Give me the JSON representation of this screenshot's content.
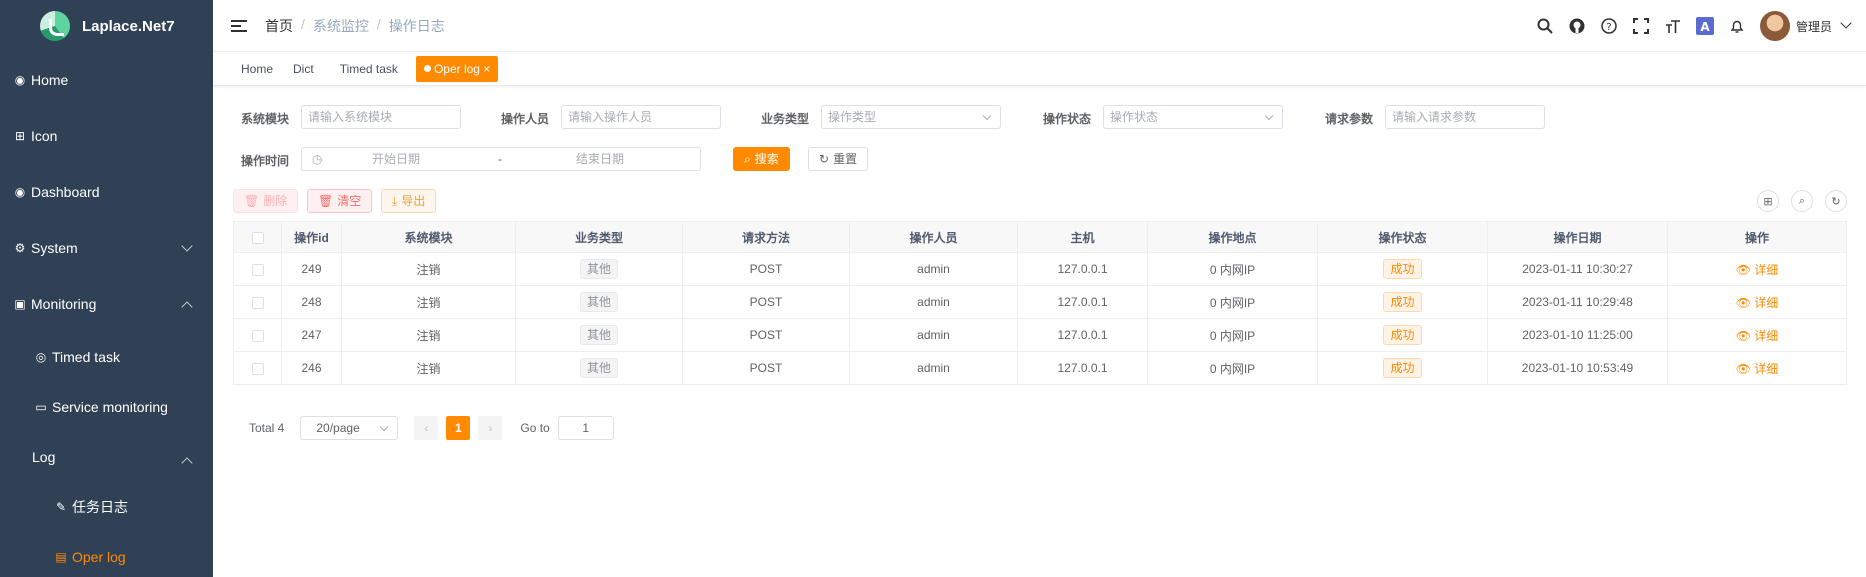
{
  "sidebar": {
    "brand": "Laplace.Net7",
    "items": [
      {
        "label": "Home"
      },
      {
        "label": "Icon"
      },
      {
        "label": "Dashboard"
      },
      {
        "label": "System"
      },
      {
        "label": "Monitoring"
      },
      {
        "label": "Timed task"
      },
      {
        "label": "Service monitoring"
      },
      {
        "label": "Log"
      },
      {
        "label": "任务日志"
      },
      {
        "label": "Oper log"
      }
    ]
  },
  "breadcrumb": [
    "首页",
    "系统监控",
    "操作日志"
  ],
  "header": {
    "user": "管理员"
  },
  "tags": [
    "Home",
    "Dict",
    "Timed task",
    "Oper log"
  ],
  "filters": {
    "module": {
      "label": "系统模块",
      "placeholder": "请输入系统模块"
    },
    "operator": {
      "label": "操作人员",
      "placeholder": "请输入操作人员"
    },
    "biz_type": {
      "label": "业务类型",
      "placeholder": "操作类型"
    },
    "status": {
      "label": "操作状态",
      "placeholder": "操作状态"
    },
    "params": {
      "label": "请求参数",
      "placeholder": "请输入请求参数"
    },
    "time": {
      "label": "操作时间",
      "start": "开始日期",
      "sep": "-",
      "end": "结束日期"
    },
    "search": "搜索",
    "reset": "重置"
  },
  "actions": {
    "delete": "删除",
    "clear": "清空",
    "export": "导出"
  },
  "table": {
    "headers": [
      "操作id",
      "系统模块",
      "业务类型",
      "请求方法",
      "操作人员",
      "主机",
      "操作地点",
      "操作状态",
      "操作日期",
      "操作"
    ],
    "rows": [
      {
        "id": "249",
        "module": "注销",
        "type": "其他",
        "method": "POST",
        "user": "admin",
        "host": "127.0.0.1",
        "loc": "0 内网IP",
        "status": "成功",
        "date": "2023-01-11 10:30:27",
        "op": "详细"
      },
      {
        "id": "248",
        "module": "注销",
        "type": "其他",
        "method": "POST",
        "user": "admin",
        "host": "127.0.0.1",
        "loc": "0 内网IP",
        "status": "成功",
        "date": "2023-01-11 10:29:48",
        "op": "详细"
      },
      {
        "id": "247",
        "module": "注销",
        "type": "其他",
        "method": "POST",
        "user": "admin",
        "host": "127.0.0.1",
        "loc": "0 内网IP",
        "status": "成功",
        "date": "2023-01-10 11:25:00",
        "op": "详细"
      },
      {
        "id": "246",
        "module": "注销",
        "type": "其他",
        "method": "POST",
        "user": "admin",
        "host": "127.0.0.1",
        "loc": "0 内网IP",
        "status": "成功",
        "date": "2023-01-10 10:53:49",
        "op": "详细"
      }
    ]
  },
  "pagination": {
    "total": "Total 4",
    "size": "20/page",
    "page": "1",
    "goto": "Go to",
    "goto_value": "1"
  }
}
